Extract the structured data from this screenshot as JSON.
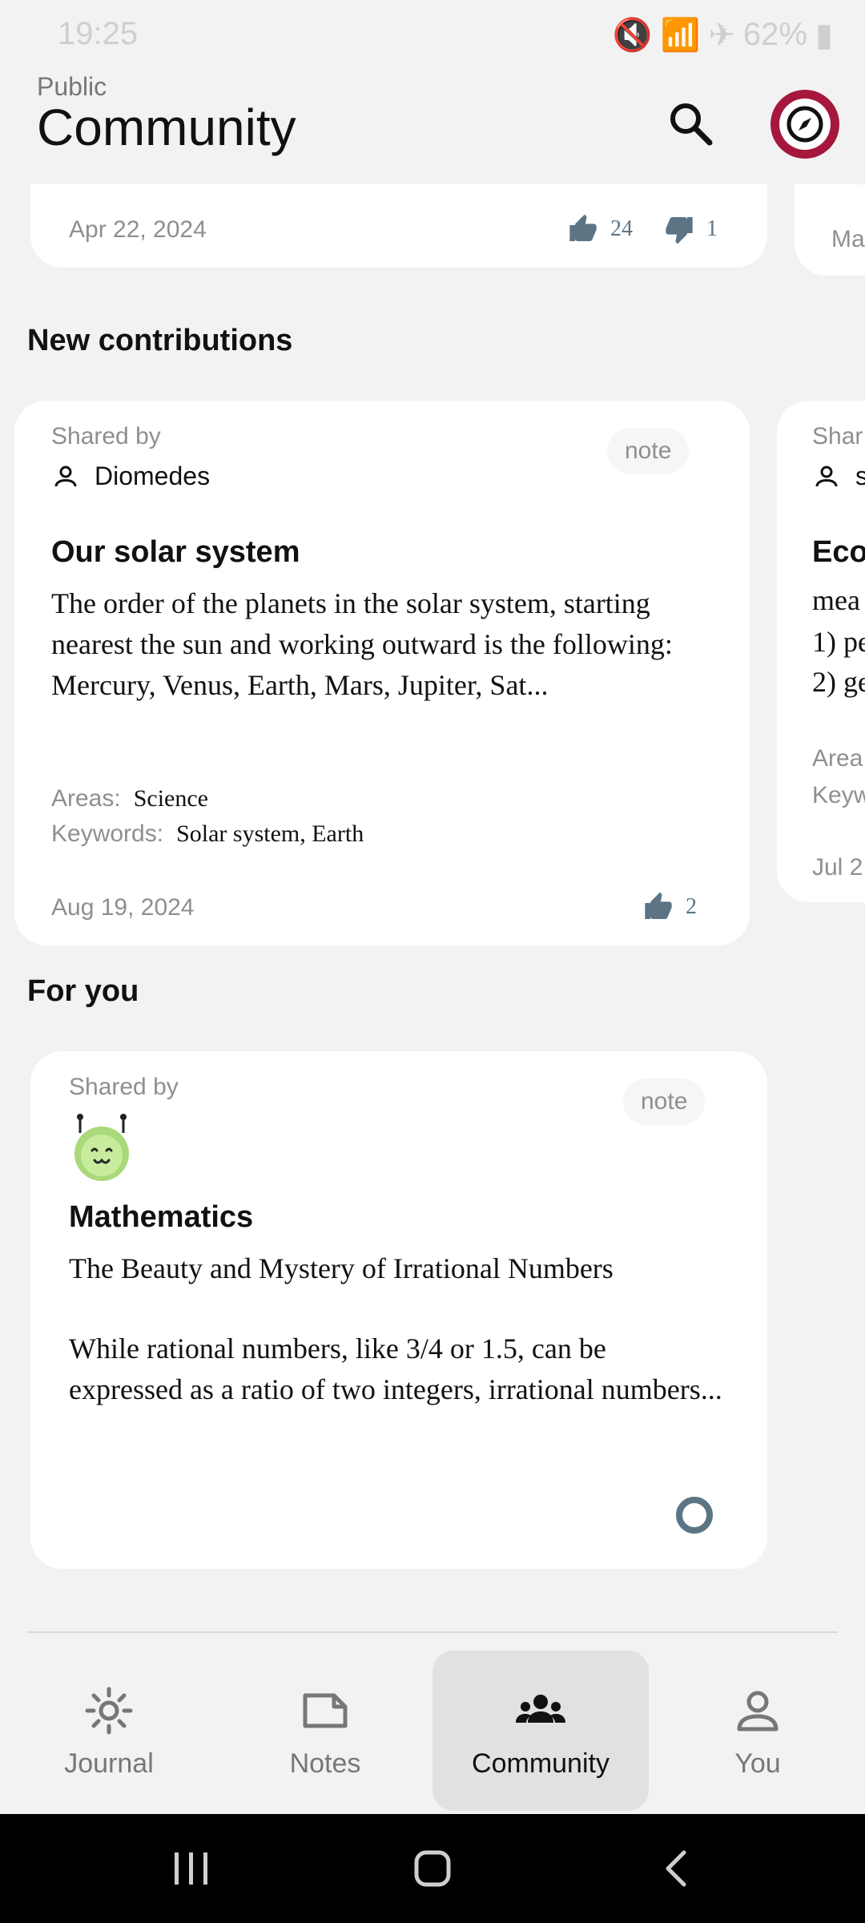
{
  "status": {
    "time": "19:25",
    "battery": "62%"
  },
  "header": {
    "subtitle": "Public",
    "title": "Community"
  },
  "top_card": {
    "date": "Apr 22, 2024",
    "likes": "24",
    "dislikes": "1",
    "right_peek_date": "Ma"
  },
  "new_contributions": {
    "title": "New contributions",
    "card": {
      "shared_by_label": "Shared by",
      "user": "Diomedes",
      "chip": "note",
      "title": "Our solar system",
      "body": "The order of the planets in the solar system, starting nearest the sun and working outward is the following: Mercury, Venus, Earth, Mars, Jupiter, Sat...",
      "areas_label": "Areas:",
      "areas_value": "Science",
      "keywords_label": "Keywords:",
      "keywords_value": "Solar system, Earth",
      "date": "Aug 19, 2024",
      "likes": "2"
    },
    "peek": {
      "shared": "Shar",
      "user": "s",
      "title": "Eco",
      "line1": "mea",
      "line2": "1) pe",
      "line3": "2) ge",
      "areas": "Area",
      "keywords": "Keyw",
      "date": "Jul 2"
    }
  },
  "for_you": {
    "title": "For you",
    "card": {
      "shared_by_label": "Shared by",
      "chip": "note",
      "title": "Mathematics",
      "body_line1": "The Beauty and Mystery of Irrational Numbers",
      "body_para": "While rational numbers, like 3/4 or 1.5, can be expressed as a ratio of two integers, irrational numbers..."
    }
  },
  "bottom_nav": {
    "items": [
      {
        "label": "Journal",
        "icon": "sun-icon"
      },
      {
        "label": "Notes",
        "icon": "note-icon"
      },
      {
        "label": "Community",
        "icon": "people-icon"
      },
      {
        "label": "You",
        "icon": "person-icon"
      }
    ],
    "active_index": 2
  },
  "colors": {
    "accent": "#a6173d",
    "icon_slate": "#5b7585"
  }
}
